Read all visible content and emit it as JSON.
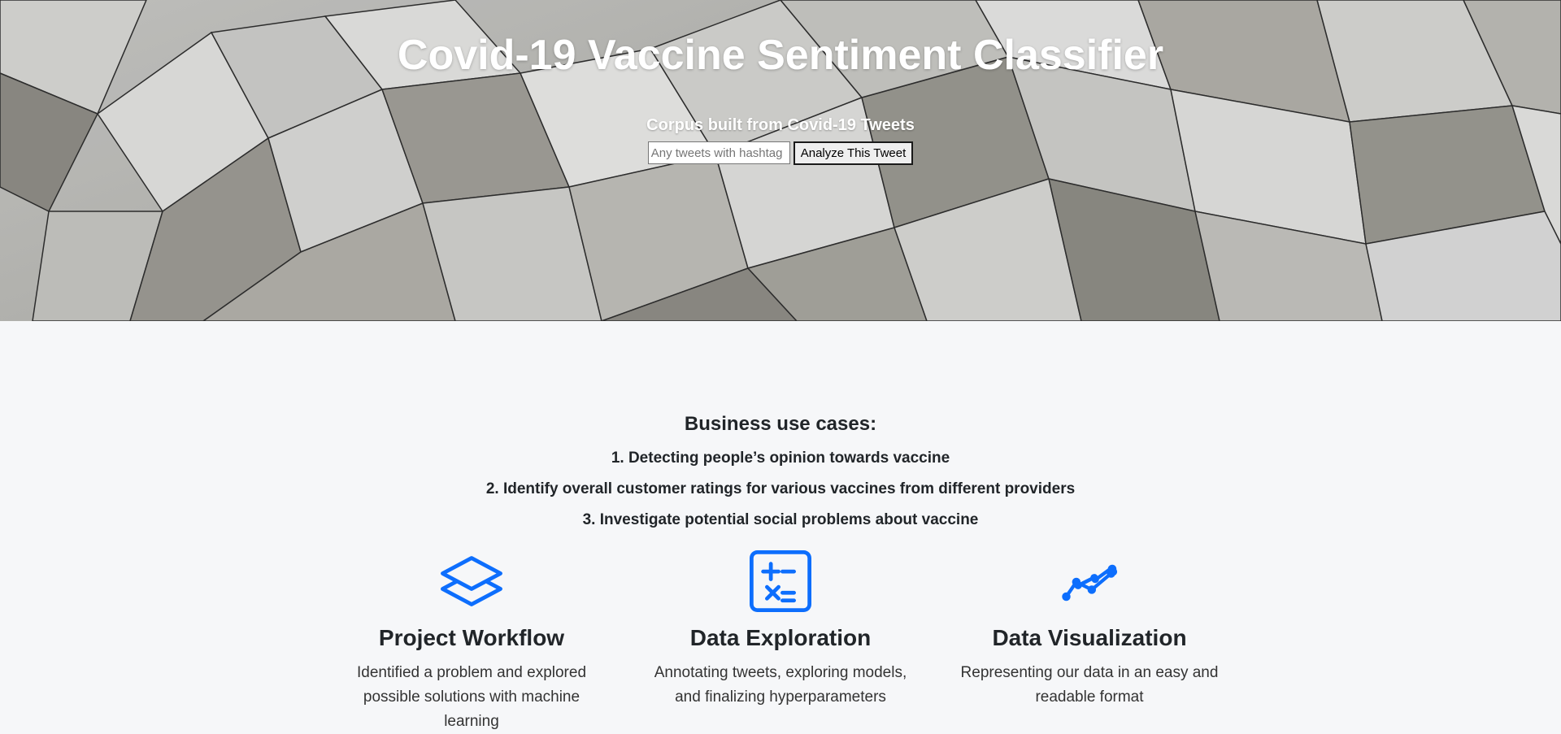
{
  "hero": {
    "title": "Covid-19 Vaccine Sentiment Classifier",
    "subtitle": "Corpus built from Covid-19 Tweets",
    "search": {
      "placeholder": "Any tweets with hashtag",
      "value": ""
    },
    "analyze_label": "Analyze This Tweet"
  },
  "use_cases": {
    "title": "Business use cases:",
    "items": [
      "1. Detecting people’s opinion towards vaccine",
      "2. Identify overall customer ratings for various vaccines from different providers",
      "3. Investigate potential social problems about vaccine"
    ]
  },
  "features": [
    {
      "icon": "layers-icon",
      "title": "Project Workflow",
      "description": "Identified a problem and explored possible solutions with machine learning"
    },
    {
      "icon": "calculator-icon",
      "title": "Data Exploration",
      "description": "Annotating tweets, exploring models, and finalizing hyperparameters"
    },
    {
      "icon": "graph-up-icon",
      "title": "Data Visualization",
      "description": "Representing our data in an easy and readable format"
    }
  ],
  "colors": {
    "accent": "#0d6efd",
    "page_background": "#f6f7f9",
    "text": "#212529"
  }
}
